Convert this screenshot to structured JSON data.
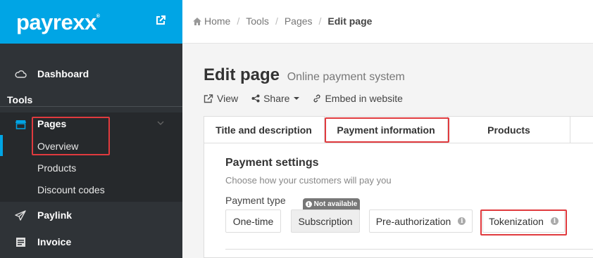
{
  "brand": {
    "logo": "payrexx",
    "trademark": "®"
  },
  "sidebar": {
    "dashboard": "Dashboard",
    "section": "Tools",
    "pages": "Pages",
    "sub_items": [
      "Overview",
      "Products",
      "Discount codes"
    ],
    "paylink": "Paylink",
    "invoice": "Invoice"
  },
  "breadcrumb": {
    "home": "Home",
    "tools": "Tools",
    "pages": "Pages",
    "current": "Edit page"
  },
  "page": {
    "title": "Edit page",
    "subtitle": "Online payment system"
  },
  "actions": {
    "view": "View",
    "share": "Share",
    "embed": "Embed in website"
  },
  "tabs": [
    "Title and description",
    "Payment information",
    "Products"
  ],
  "payment_settings": {
    "title": "Payment settings",
    "subtitle": "Choose how your customers will pay you",
    "type_label": "Payment type",
    "options": [
      "One-time",
      "Subscription",
      "Pre-authorization",
      "Tokenization"
    ],
    "badge": "Not available"
  },
  "colors": {
    "brand": "#00a5e5",
    "sidebar": "#2f3337",
    "highlight": "#e03a3e"
  }
}
